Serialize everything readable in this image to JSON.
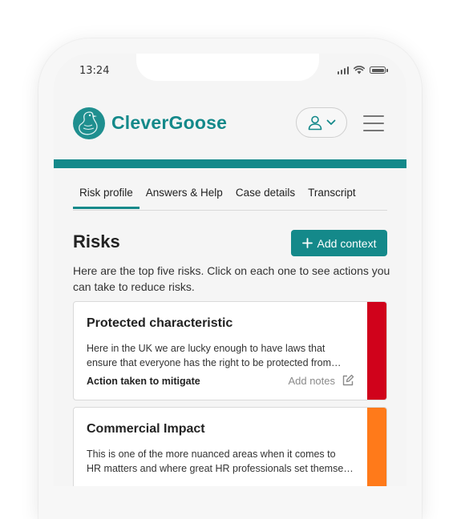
{
  "status_bar": {
    "time": "13:24"
  },
  "brand": {
    "name": "CleverGoose",
    "color": "#14898a"
  },
  "tabs": [
    {
      "label": "Risk profile",
      "active": true
    },
    {
      "label": "Answers & Help",
      "active": false
    },
    {
      "label": "Case details",
      "active": false
    },
    {
      "label": "Transcript",
      "active": false
    }
  ],
  "risks": {
    "title": "Risks",
    "add_button_label": "Add context",
    "intro": "Here are the top five risks. Click on each one to see actions you can take to reduce risks."
  },
  "cards": [
    {
      "title": "Protected characteristic",
      "desc_line1": "Here in the UK we are lucky enough to have laws that",
      "desc_line2": "ensure that everyone has the right to be protected from…",
      "mitigate_label": "Action taken to mitigate",
      "notes_label": "Add notes",
      "severity_color": "#d0021b"
    },
    {
      "title": "Commercial Impact",
      "desc_line1": "This is one of the more nuanced areas when it comes to",
      "desc_line2": "HR matters and where great HR professionals set themse…",
      "severity_color": "#ff7a1a"
    }
  ]
}
